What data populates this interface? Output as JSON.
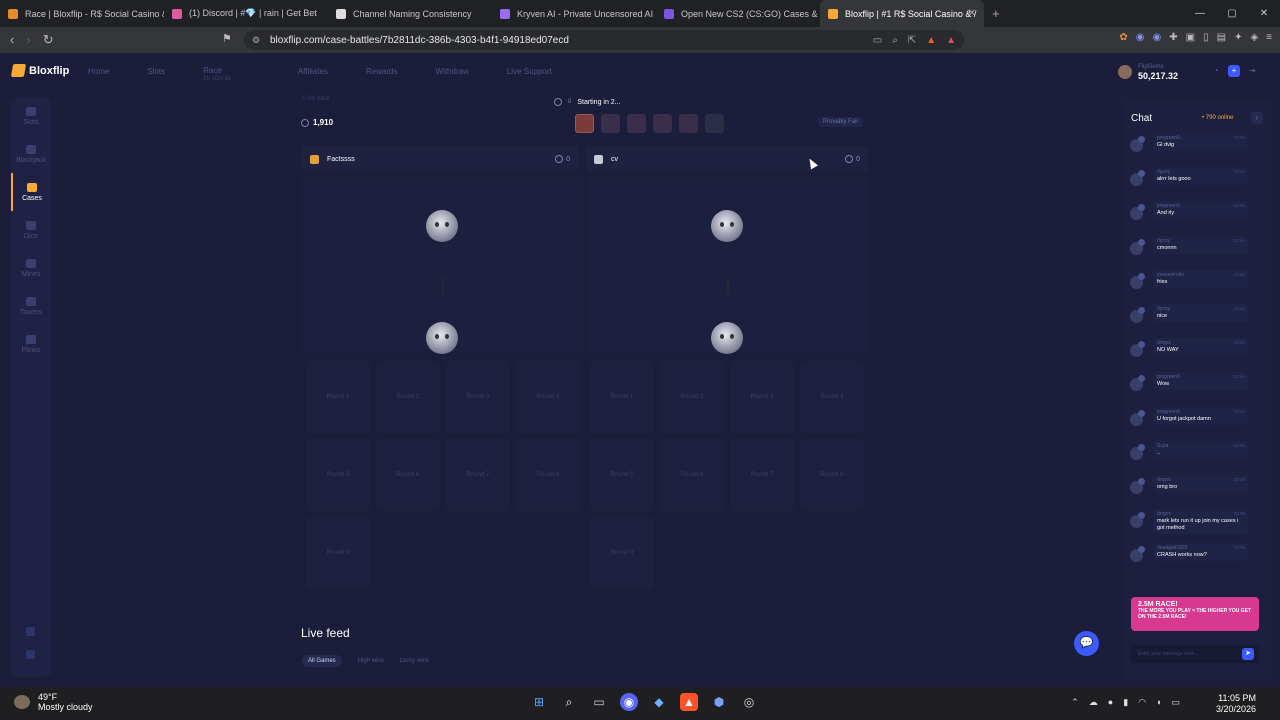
{
  "browser": {
    "tabs": [
      {
        "title": "Race | Bloxflip - R$ Social Casino & A",
        "color": "#e58b2e",
        "active": false
      },
      {
        "title": "(1) Discord | #💎 | rain | Get Bet",
        "color": "#e05aa0",
        "active": false
      },
      {
        "title": "Channel Naming Consistency",
        "color": "#dddddd",
        "active": false
      },
      {
        "title": "Kryven AI - Private Uncensored AI Ch",
        "color": "#9a6cf0",
        "active": false
      },
      {
        "title": "Open New CS2 (CS:GO) Cases & Get",
        "color": "#7a55e0",
        "active": false
      },
      {
        "title": "Bloxflip | #1 R$ Social Casino & /",
        "color": "#f7a935",
        "active": true
      }
    ],
    "new_tab": "+",
    "url": "bloxflip.com/case-battles/7b2811dc-386b-4303-b4f1-94918ed07ecd",
    "window_controls": [
      "—",
      "▢",
      "✕"
    ]
  },
  "site": {
    "logo": "Bloxflip",
    "nav": [
      "Home",
      "Slots",
      "Race",
      "Affiliates",
      "Rewards",
      "Withdraw",
      "Live Support"
    ],
    "race_sub": "2h 10m 8s",
    "user": {
      "name": "FlipGems",
      "balance": "50,217.32"
    },
    "sidebar": [
      {
        "label": "Slots",
        "active": false
      },
      {
        "label": "Blackjack",
        "active": false
      },
      {
        "label": "Cases",
        "active": true
      },
      {
        "label": "Dice",
        "active": false
      },
      {
        "label": "Mines",
        "active": false
      },
      {
        "label": "Towers",
        "active": false
      },
      {
        "label": "Plinko",
        "active": false
      }
    ]
  },
  "battle": {
    "back": "< Go back",
    "total": "1,910",
    "rounds_done": "0",
    "status": "Starting in 2...",
    "provably_fair": "Provably Fair",
    "players": [
      {
        "name": "Factssss",
        "score": "0"
      },
      {
        "name": "cv",
        "score": "0"
      }
    ],
    "rounds_left": [
      "Round 1",
      "Round 2",
      "Round 3",
      "Round 4",
      "Round 5",
      "Round 6",
      "Round 7",
      "Round 8",
      "Round 9"
    ],
    "rounds_right": [
      "Round 1",
      "Round 2",
      "Round 3",
      "Round 4",
      "Round 5",
      "Round 6",
      "Round 7",
      "Round 8",
      "Round 9"
    ]
  },
  "live_feed": {
    "title": "Live feed",
    "filters": [
      "All Games",
      "High wins",
      "Lucky wins"
    ]
  },
  "chat": {
    "title": "Chat",
    "online": "• 790 online",
    "messages": [
      {
        "user": "progreen9",
        "text": "Gl dvig",
        "time": "23:04"
      },
      {
        "user": "rlyzoy",
        "text": "alrrr lets gooo",
        "time": "23:04"
      },
      {
        "user": "progreen9",
        "text": "And rly",
        "time": "23:04"
      },
      {
        "user": "rlyzoy",
        "text": "cmonnn",
        "time": "23:04"
      },
      {
        "user": "yeeeesirrski",
        "text": "fries",
        "time": "23:04"
      },
      {
        "user": "rlyzoy",
        "text": "nice",
        "time": "23:04"
      },
      {
        "user": "drrgvs",
        "text": "NO WAY",
        "time": "23:04"
      },
      {
        "user": "progreen9",
        "text": "Wow",
        "time": "23:04"
      },
      {
        "user": "progreen9",
        "text": "U forgot jackpot damn",
        "time": "23:04"
      },
      {
        "user": "Scpa",
        "text": "..",
        "time": "23:05"
      },
      {
        "user": "drrgvs",
        "text": "omg bro",
        "time": "23:05"
      },
      {
        "user": "drrgvs",
        "text": "mark lets run it up join my cases i got method",
        "time": "23:05"
      },
      {
        "user": "deadgod1828",
        "text": "CRASH works now?",
        "time": "23:05"
      }
    ],
    "promo_title": "2.5M RACE!",
    "promo_text": "THE MORE YOU PLAY = THE HIGHER YOU GET ON THE 2.5M RACE!",
    "input_placeholder": "Enter your message here..."
  },
  "taskbar": {
    "temp": "49°F",
    "weather": "Mostly cloudy",
    "time": "11:05 PM",
    "date": "3/20/2026"
  }
}
